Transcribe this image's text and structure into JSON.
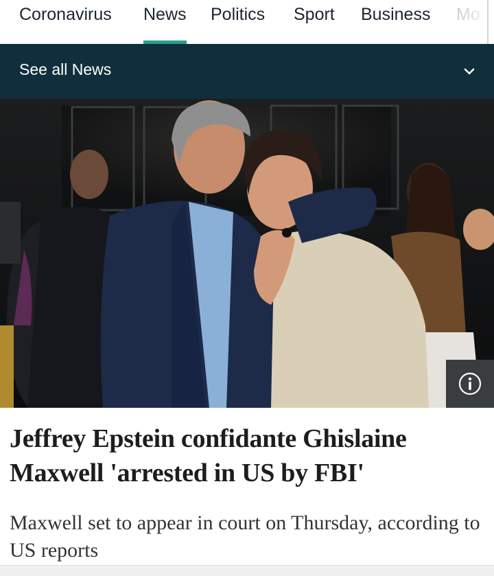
{
  "nav": {
    "tabs": [
      {
        "label": "Coronavirus",
        "active": false
      },
      {
        "label": "News",
        "active": true
      },
      {
        "label": "Politics",
        "active": false
      },
      {
        "label": "Sport",
        "active": false
      },
      {
        "label": "Business",
        "active": false
      },
      {
        "label": "Mo",
        "active": false
      }
    ]
  },
  "section_bar": {
    "label": "See all News",
    "icon": "chevron-down-icon"
  },
  "photo": {
    "info_icon": "info-icon"
  },
  "article": {
    "headline": "Jeffrey Epstein confidante Ghislaine Maxwell 'arrested in US by FBI'",
    "standfirst": "Maxwell set to appear in court on Thursday, according to US reports"
  },
  "colors": {
    "accent": "#2a9d8f",
    "section_bar_bg": "#0f2f3c"
  }
}
